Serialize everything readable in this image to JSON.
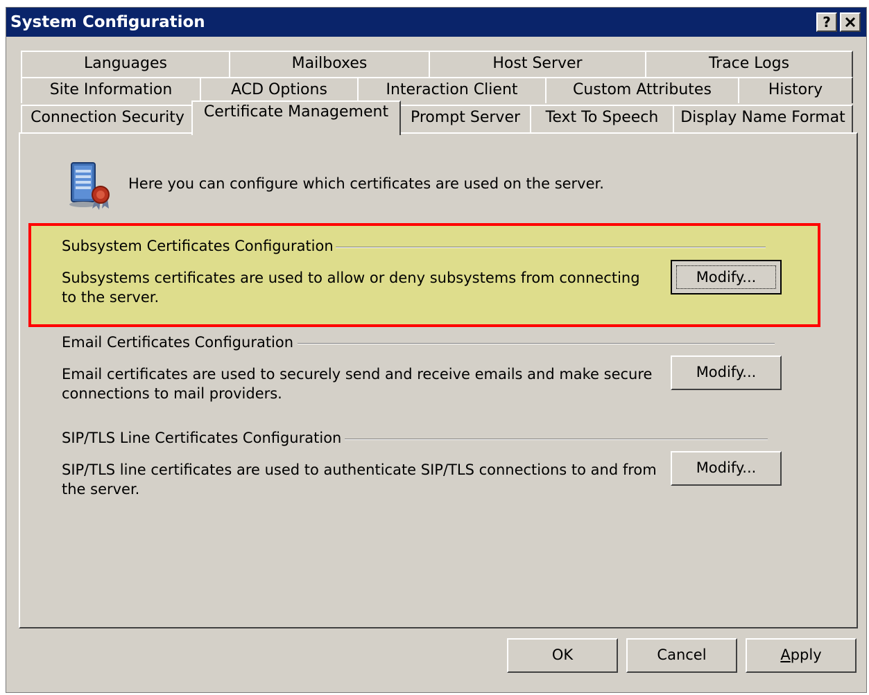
{
  "window": {
    "title": "System Configuration",
    "help_button": "?",
    "close_button": "✕"
  },
  "tabs": {
    "row1": [
      "Languages",
      "Mailboxes",
      "Host Server",
      "Trace Logs"
    ],
    "row2": [
      "Site Information",
      "ACD Options",
      "Interaction Client",
      "Custom Attributes",
      "History"
    ],
    "row3": [
      "Connection Security",
      "Certificate Management",
      "Prompt Server",
      "Text To Speech",
      "Display Name Format"
    ],
    "active": "Certificate Management"
  },
  "intro": {
    "icon": "server-certificate-icon",
    "text": "Here you can configure which certificates are used on the server."
  },
  "sections": [
    {
      "title": "Subsystem Certificates Configuration",
      "description": "Subsystems certificates are used to allow or deny subsystems from connecting to the server.",
      "button": "Modify..."
    },
    {
      "title": "Email Certificates Configuration",
      "description": "Email certificates are used to securely send and receive emails and make secure connections to mail providers.",
      "button": "Modify..."
    },
    {
      "title": "SIP/TLS Line Certificates Configuration",
      "description": "SIP/TLS line certificates are used to authenticate SIP/TLS connections to and from the server.",
      "button": "Modify..."
    }
  ],
  "highlight_color": "#ff0000",
  "footer": {
    "ok": "OK",
    "cancel": "Cancel",
    "apply": "Apply"
  }
}
